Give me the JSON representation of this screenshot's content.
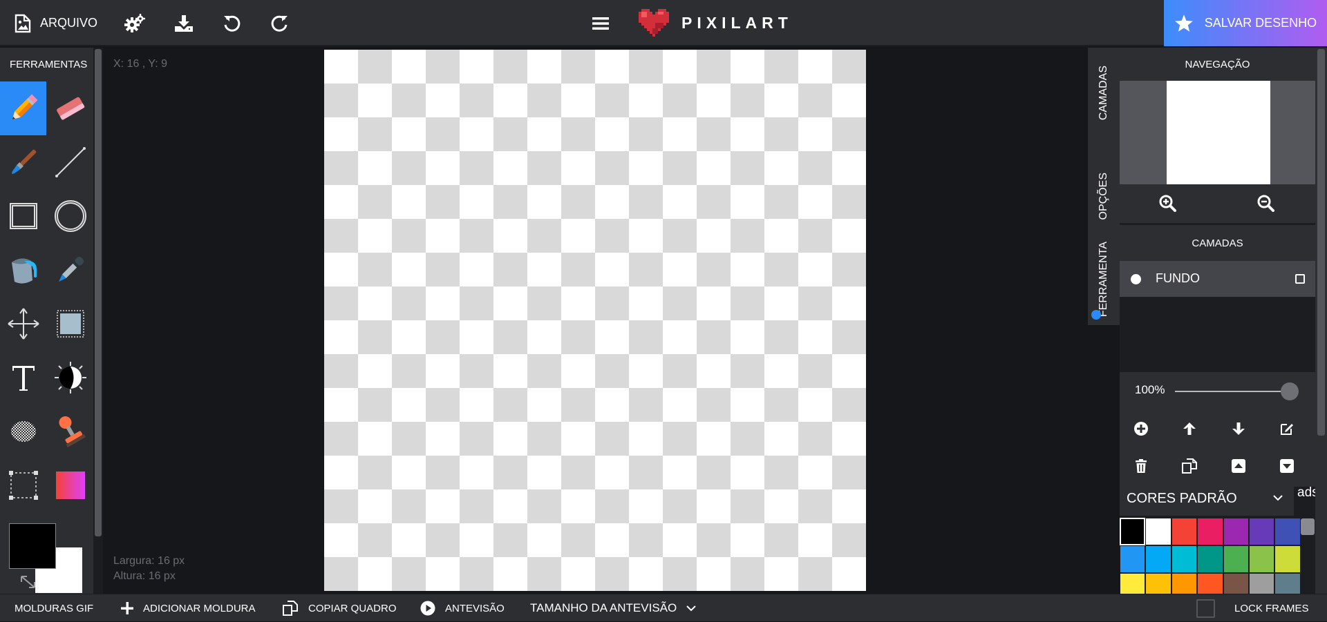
{
  "toolbar": {
    "file_label": "ARQUIVO",
    "logo_text": "PIXILART",
    "save_label": "SALVAR DESENHO"
  },
  "tools_panel": {
    "title": "FERRAMENTAS",
    "tools": [
      "pencil",
      "eraser",
      "brush",
      "line",
      "rectangle",
      "circle",
      "bucket",
      "eyedropper",
      "move",
      "selection",
      "text",
      "lighten-darken",
      "dither",
      "stamp",
      "crop",
      "gradient"
    ],
    "active_tool": "pencil",
    "primary_color": "#000000",
    "secondary_color": "#ffffff"
  },
  "canvas": {
    "coords": "X: 16 , Y: 9",
    "width_label": "Largura: 16 px",
    "height_label": "Altura: 16 px"
  },
  "side_tabs": [
    "CAMADAS",
    "OPÇÕES",
    "FERRAMENTA"
  ],
  "navigation": {
    "title": "NAVEGAÇÃO"
  },
  "layers": {
    "title": "CAMADAS",
    "items": [
      {
        "name": "FUNDO"
      }
    ],
    "opacity": "100%"
  },
  "palette": {
    "title": "CORES PADRÃO",
    "ads_label": "ads",
    "colors": [
      "#000000",
      "#ffffff",
      "#f44336",
      "#e91e63",
      "#9c27b0",
      "#673ab7",
      "#3f51b5",
      "#2196f3",
      "#03a9f4",
      "#00bcd4",
      "#009688",
      "#4caf50",
      "#8bc34a",
      "#cddc39",
      "#ffeb3b",
      "#ffc107",
      "#ff9800",
      "#ff5722",
      "#795548",
      "#9e9e9e",
      "#607d8b"
    ],
    "selected": "#000000"
  },
  "bottombar": {
    "gif_frames": "MOLDURAS GIF",
    "add_frame": "ADICIONAR MOLDURA",
    "copy_frame": "COPIAR QUADRO",
    "preview": "ANTEVISÃO",
    "preview_size": "TAMANHO DA ANTEVISÃO",
    "lock_frames": "LOCK FRAMES"
  },
  "colors": {
    "accent": "#2a8af6",
    "panel": "#2d2e32",
    "background": "#16171b"
  }
}
